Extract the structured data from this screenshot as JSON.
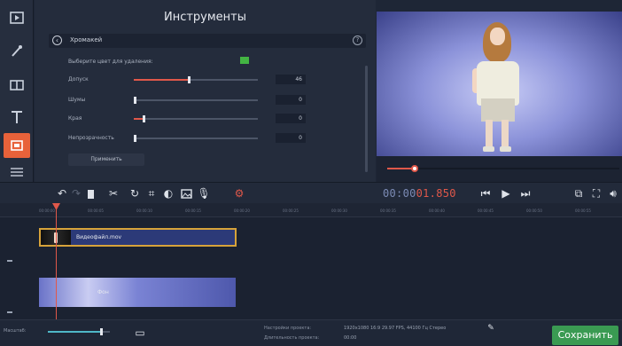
{
  "tools": {
    "title": "Инструменты",
    "chroma_label": "Хромакей",
    "pick_color_label": "Выберите цвет для удаления:",
    "key_color": "#43b443",
    "apply_label": "Применить",
    "params": [
      {
        "label": "Допуск",
        "value": "46",
        "level": 0.44
      },
      {
        "label": "Шумы",
        "value": "0",
        "level": 0.0
      },
      {
        "label": "Края",
        "value": "0",
        "level": 0.08
      },
      {
        "label": "Непрозрачность",
        "value": "0",
        "level": 0.0
      }
    ]
  },
  "preview": {
    "progress": 0.12
  },
  "player": {
    "time_main": "00:00",
    "time_frac": "01.850"
  },
  "timeline": {
    "video_clip_label": "Видеофайл.mov",
    "bg_clip_label": "Фон",
    "ruler_ticks": [
      "00:00:00",
      "00:00:05",
      "00:00:10",
      "00:00:15",
      "00:00:20",
      "00:00:25",
      "00:00:30",
      "00:00:35",
      "00:00:40",
      "00:00:45",
      "00:00:50",
      "00:00:55",
      "00:01:00"
    ]
  },
  "status": {
    "zoom_label": "Масштаб:",
    "zoom_level": 0.85,
    "project_settings_label": "Настройки проекта:",
    "project_settings_value": "1920x1080 16:9 29.97 FPS, 44100 Гц Стерео",
    "duration_label": "Длительность проекта:",
    "duration_value": "00:00",
    "save_label": "Сохранить"
  },
  "colors": {
    "accent": "#e0584a",
    "save": "#3a9a52",
    "clip_border": "#d7a33a"
  }
}
